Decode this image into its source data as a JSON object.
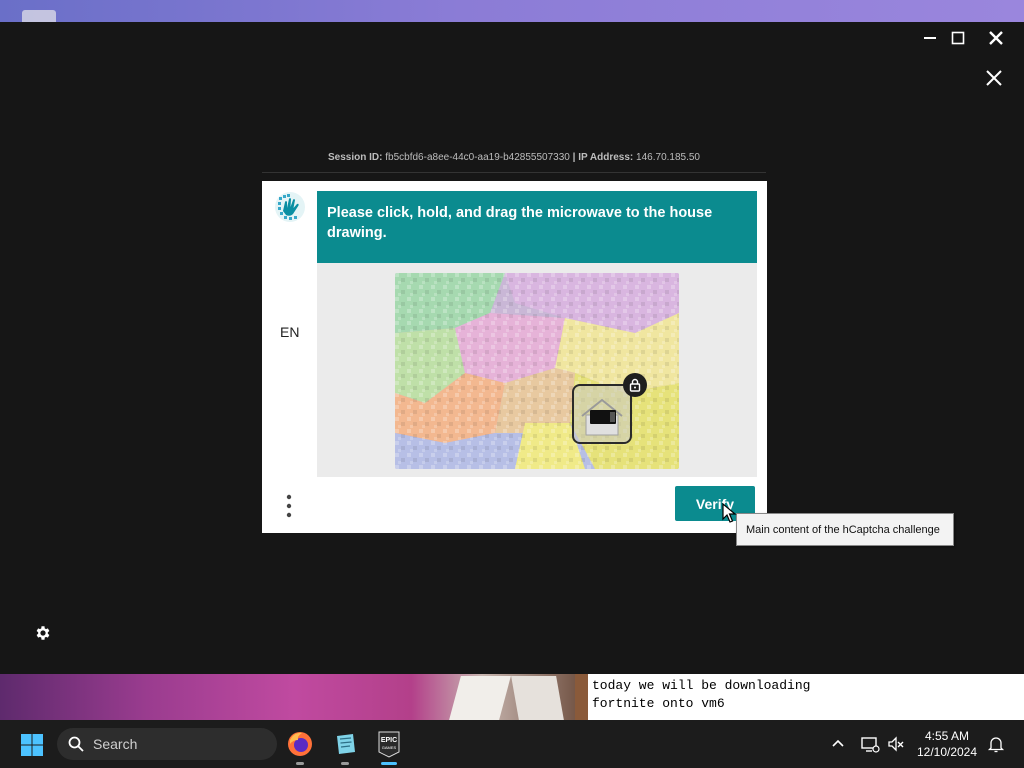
{
  "window": {
    "session_label": "Session ID:",
    "session_id": "fb5cbfd6-a8ee-44c0-aa19-b42855507330",
    "separator": "|",
    "ip_label": "IP Address:",
    "ip_address": "146.70.185.50"
  },
  "captcha": {
    "language": "EN",
    "prompt": "Please click, hold, and drag the microwave to the house drawing.",
    "verify_label": "Verify",
    "tooltip": "Main content of the hCaptcha challenge",
    "accent_color": "#0b8b8f"
  },
  "stream": {
    "chat_line1": "today we will be downloading",
    "chat_line2": "fortnite onto vm6"
  },
  "taskbar": {
    "search_placeholder": "Search",
    "time": "4:55 AM",
    "date": "12/10/2024",
    "apps": [
      "firefox-icon",
      "notes-icon",
      "epic-games-icon"
    ]
  }
}
